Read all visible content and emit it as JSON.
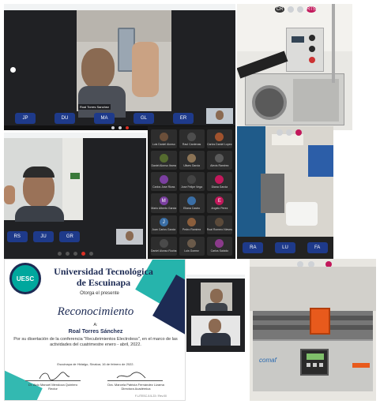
{
  "tl": {
    "name_tag": "Roal Torres Sanchez",
    "participants": [
      "JP",
      "DU",
      "MA",
      "GL",
      "ER"
    ]
  },
  "tr": {
    "top_badges": [
      "CR",
      "RTS"
    ]
  },
  "ml": {
    "participants": [
      "RS",
      "JU",
      "GR"
    ]
  },
  "mm": {
    "names": [
      "Luis Daniel Alonso",
      "Raul Cardenas",
      "Carlos Daniel Lopez",
      "Daniel Alonso Ibarra",
      "Ulises Garcia",
      "Alexis Ramirez",
      "Carlos Jose Rivas",
      "Jose Felipe Vega",
      "Diana Garcia",
      "Mario Alberto Garcia",
      "Eliana Castro",
      "Angelo Perez",
      "Juan Carlos Garcia",
      "Pedro Ramirez",
      "Roal Romero Nieves",
      "Daniel Alonso Rocha",
      "Luis Gomez",
      "Carlos Salcido"
    ],
    "initials": [
      "",
      "",
      "",
      "",
      "",
      "",
      "",
      "",
      "",
      "M",
      "",
      "E",
      "J",
      "",
      "",
      "",
      "",
      ""
    ]
  },
  "mr": {
    "participants": [
      "RA",
      "LU",
      "FA"
    ]
  },
  "cert": {
    "institution_line1": "Universidad Tecnológica",
    "institution_line2": "de Escuinapa",
    "logo_letters": "UESC",
    "grants": "Otorga el presente",
    "award": "Reconocimiento",
    "to": "A:",
    "recipient": "Roal Torres Sánchez",
    "body": "Por su disertación de la conferencia \"Recubrimientos Electroless\", en el marco de las actividades del cuatrimestre enero - abril, 2022.",
    "place_date": "Escuinapa de Hidalgo, Sinaloa; 16 de febrero de 2022.",
    "sig1_name": "Dr. Aldo Manuel Mendoza Quintero",
    "sig1_role": "Rector",
    "sig2_name": "Dra. Marcela Patricia Fernández Lizama",
    "sig2_role": "Directora Académica",
    "footer_code": "F-UTESC-5.5-23 / Rev.00"
  },
  "br": {
    "brand": "comaf"
  },
  "colors": {
    "zoom_blue": "#1e3a8a",
    "end_red": "#d93025",
    "cert_navy": "#1d2b54",
    "cert_teal": "#00a79d"
  }
}
